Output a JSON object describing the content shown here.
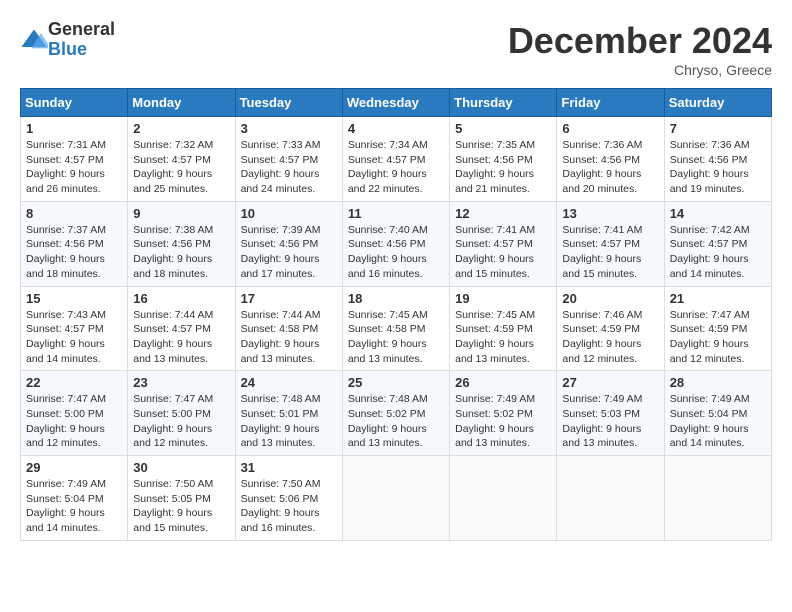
{
  "header": {
    "logo_general": "General",
    "logo_blue": "Blue",
    "month_title": "December 2024",
    "subtitle": "Chryso, Greece"
  },
  "days_of_week": [
    "Sunday",
    "Monday",
    "Tuesday",
    "Wednesday",
    "Thursday",
    "Friday",
    "Saturday"
  ],
  "weeks": [
    [
      {
        "day": "1",
        "sunrise": "7:31 AM",
        "sunset": "4:57 PM",
        "daylight": "9 hours and 26 minutes."
      },
      {
        "day": "2",
        "sunrise": "7:32 AM",
        "sunset": "4:57 PM",
        "daylight": "9 hours and 25 minutes."
      },
      {
        "day": "3",
        "sunrise": "7:33 AM",
        "sunset": "4:57 PM",
        "daylight": "9 hours and 24 minutes."
      },
      {
        "day": "4",
        "sunrise": "7:34 AM",
        "sunset": "4:57 PM",
        "daylight": "9 hours and 22 minutes."
      },
      {
        "day": "5",
        "sunrise": "7:35 AM",
        "sunset": "4:56 PM",
        "daylight": "9 hours and 21 minutes."
      },
      {
        "day": "6",
        "sunrise": "7:36 AM",
        "sunset": "4:56 PM",
        "daylight": "9 hours and 20 minutes."
      },
      {
        "day": "7",
        "sunrise": "7:36 AM",
        "sunset": "4:56 PM",
        "daylight": "9 hours and 19 minutes."
      }
    ],
    [
      {
        "day": "8",
        "sunrise": "7:37 AM",
        "sunset": "4:56 PM",
        "daylight": "9 hours and 18 minutes."
      },
      {
        "day": "9",
        "sunrise": "7:38 AM",
        "sunset": "4:56 PM",
        "daylight": "9 hours and 18 minutes."
      },
      {
        "day": "10",
        "sunrise": "7:39 AM",
        "sunset": "4:56 PM",
        "daylight": "9 hours and 17 minutes."
      },
      {
        "day": "11",
        "sunrise": "7:40 AM",
        "sunset": "4:56 PM",
        "daylight": "9 hours and 16 minutes."
      },
      {
        "day": "12",
        "sunrise": "7:41 AM",
        "sunset": "4:57 PM",
        "daylight": "9 hours and 15 minutes."
      },
      {
        "day": "13",
        "sunrise": "7:41 AM",
        "sunset": "4:57 PM",
        "daylight": "9 hours and 15 minutes."
      },
      {
        "day": "14",
        "sunrise": "7:42 AM",
        "sunset": "4:57 PM",
        "daylight": "9 hours and 14 minutes."
      }
    ],
    [
      {
        "day": "15",
        "sunrise": "7:43 AM",
        "sunset": "4:57 PM",
        "daylight": "9 hours and 14 minutes."
      },
      {
        "day": "16",
        "sunrise": "7:44 AM",
        "sunset": "4:57 PM",
        "daylight": "9 hours and 13 minutes."
      },
      {
        "day": "17",
        "sunrise": "7:44 AM",
        "sunset": "4:58 PM",
        "daylight": "9 hours and 13 minutes."
      },
      {
        "day": "18",
        "sunrise": "7:45 AM",
        "sunset": "4:58 PM",
        "daylight": "9 hours and 13 minutes."
      },
      {
        "day": "19",
        "sunrise": "7:45 AM",
        "sunset": "4:59 PM",
        "daylight": "9 hours and 13 minutes."
      },
      {
        "day": "20",
        "sunrise": "7:46 AM",
        "sunset": "4:59 PM",
        "daylight": "9 hours and 12 minutes."
      },
      {
        "day": "21",
        "sunrise": "7:47 AM",
        "sunset": "4:59 PM",
        "daylight": "9 hours and 12 minutes."
      }
    ],
    [
      {
        "day": "22",
        "sunrise": "7:47 AM",
        "sunset": "5:00 PM",
        "daylight": "9 hours and 12 minutes."
      },
      {
        "day": "23",
        "sunrise": "7:47 AM",
        "sunset": "5:00 PM",
        "daylight": "9 hours and 12 minutes."
      },
      {
        "day": "24",
        "sunrise": "7:48 AM",
        "sunset": "5:01 PM",
        "daylight": "9 hours and 13 minutes."
      },
      {
        "day": "25",
        "sunrise": "7:48 AM",
        "sunset": "5:02 PM",
        "daylight": "9 hours and 13 minutes."
      },
      {
        "day": "26",
        "sunrise": "7:49 AM",
        "sunset": "5:02 PM",
        "daylight": "9 hours and 13 minutes."
      },
      {
        "day": "27",
        "sunrise": "7:49 AM",
        "sunset": "5:03 PM",
        "daylight": "9 hours and 13 minutes."
      },
      {
        "day": "28",
        "sunrise": "7:49 AM",
        "sunset": "5:04 PM",
        "daylight": "9 hours and 14 minutes."
      }
    ],
    [
      {
        "day": "29",
        "sunrise": "7:49 AM",
        "sunset": "5:04 PM",
        "daylight": "9 hours and 14 minutes."
      },
      {
        "day": "30",
        "sunrise": "7:50 AM",
        "sunset": "5:05 PM",
        "daylight": "9 hours and 15 minutes."
      },
      {
        "day": "31",
        "sunrise": "7:50 AM",
        "sunset": "5:06 PM",
        "daylight": "9 hours and 16 minutes."
      },
      null,
      null,
      null,
      null
    ]
  ],
  "labels": {
    "sunrise": "Sunrise:",
    "sunset": "Sunset:",
    "daylight": "Daylight:"
  }
}
